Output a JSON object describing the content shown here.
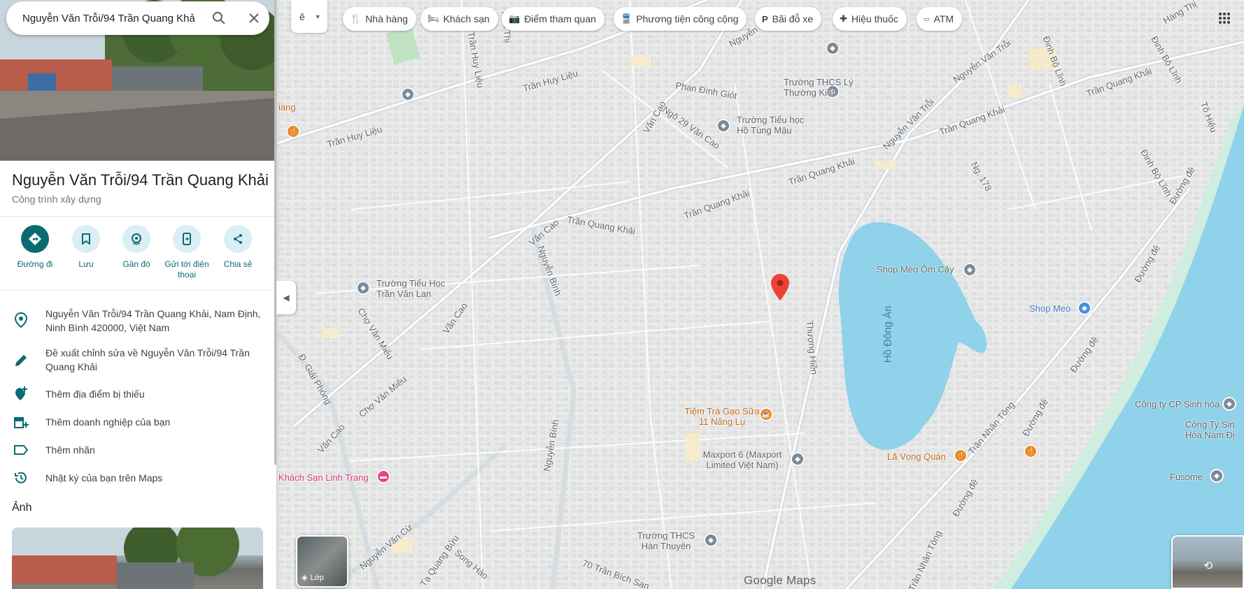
{
  "search": {
    "query": "Nguyễn Văn Trỗi/94 Trần Quang Khả"
  },
  "place": {
    "title": "Nguyễn Văn Trỗi/94 Trần Quang Khải",
    "category": "Công trình xây dựng"
  },
  "actions": [
    {
      "label": "Đường đi",
      "icon": "directions-icon"
    },
    {
      "label": "Lưu",
      "icon": "bookmark-icon"
    },
    {
      "label": "Gần đó",
      "icon": "nearby-icon"
    },
    {
      "label": "Gửi tới điện thoại",
      "icon": "send-to-phone-icon"
    },
    {
      "label": "Chia sẻ",
      "icon": "share-icon"
    }
  ],
  "info": [
    {
      "text": "Nguyễn Văn Trỗi/94 Trần Quang Khải, Nam Định, Ninh Bình 420000, Việt Nam",
      "icon": "location-pin-icon"
    },
    {
      "text": "Đề xuất chỉnh sửa về Nguyễn Văn Trỗi/94 Trần Quang Khải",
      "icon": "pencil-icon"
    },
    {
      "text": "Thêm địa điểm bị thiếu",
      "icon": "add-place-icon"
    },
    {
      "text": "Thêm doanh nghiệp của bạn",
      "icon": "add-business-icon"
    },
    {
      "text": "Thêm nhãn",
      "icon": "label-icon"
    },
    {
      "text": "Nhật ký của bạn trên Maps",
      "icon": "history-icon"
    }
  ],
  "photos_heading": "Ảnh",
  "ime_label": "ê",
  "chips": [
    {
      "label": "Nhà hàng",
      "icon": "restaurant-icon"
    },
    {
      "label": "Khách sạn",
      "icon": "hotel-icon"
    },
    {
      "label": "Điểm tham quan",
      "icon": "camera-icon"
    },
    {
      "label": "Phương tiện công cộng",
      "icon": "transit-icon"
    },
    {
      "label": "Bãi đỗ xe",
      "icon": "parking-icon"
    },
    {
      "label": "Hiệu thuốc",
      "icon": "pharmacy-icon"
    },
    {
      "label": "ATM",
      "icon": "atm-icon"
    }
  ],
  "layers_label": "Lớp",
  "brand": "Google Maps",
  "map": {
    "streets": [
      "Trần Huy Liệu",
      "Trần Huy Liệu",
      "Đ. Trần Huy Liệu",
      "Trần Thị",
      "Văn Cao",
      "Văn Cao",
      "Văn Cao",
      "Văn Cao",
      "Phan Đình Giót",
      "Ngõ 29 Văn Cao",
      "Trần Quang Khải",
      "Trần Quang Khải",
      "Trần Quang Khải",
      "Trần Quang Khải",
      "Trần Quang Khải",
      "Nguyễn Văn Trỗi",
      "Nguyễn Văn Trỗi",
      "Nguyễn Bính",
      "Nguyễn Bính",
      "Đinh Bộ Lĩnh",
      "Đinh Bộ Lĩnh",
      "Đinh Bộ Lĩnh",
      "Ng. 178",
      "Tô Hiệu",
      "Đường đê",
      "Đường đê",
      "Đường đê",
      "Đường đê",
      "Đường đê",
      "Thượng Hiền",
      "Chợ Văn Miếu",
      "Chợ Văn Miếu",
      "Đ. Giải Phóng",
      "Trần Nhân Tông",
      "Trần Nhân Tông",
      "Nguyễn Văn Cừ",
      "Tạ Quang Bửu",
      "Song Hào",
      "70 Trần Bích San",
      "Hàng Thị",
      "Nguyễn"
    ],
    "lake": "Hồ Đông Án",
    "pois": [
      {
        "name": "Trường THCS Lý Thường Kiệt",
        "type": "school"
      },
      {
        "name": "Trường Tiểu học Hồ Tùng Mậu",
        "type": "school"
      },
      {
        "name": "Trường Tiểu Học Trần Văn Lan",
        "type": "school"
      },
      {
        "name": "Shop Mèo Ôm Cây",
        "type": "shop"
      },
      {
        "name": "Shop Meo",
        "type": "shop-blue"
      },
      {
        "name": "Tiệm Trà Gạo Sữa 11 Năng Lụ",
        "type": "food"
      },
      {
        "name": "Maxport 6 (Maxport Limited Việt Nam)",
        "type": "business"
      },
      {
        "name": "Lã Vọng Quán",
        "type": "food"
      },
      {
        "name": "Khách Sạn Linh Trang",
        "type": "hotel"
      },
      {
        "name": "Trường THCS Hàn Thuyên",
        "type": "school"
      },
      {
        "name": "Công ty CP Sinh hóa",
        "type": "business"
      },
      {
        "name": "Công Ty Sin Hóa Nam Đị",
        "type": "business"
      },
      {
        "name": "Fusome",
        "type": "business"
      },
      {
        "name": "iang",
        "type": "food"
      }
    ],
    "marker_color": "#ea4335",
    "lake_color": "#8fd2ea",
    "river_color": "#8fd2ea"
  }
}
